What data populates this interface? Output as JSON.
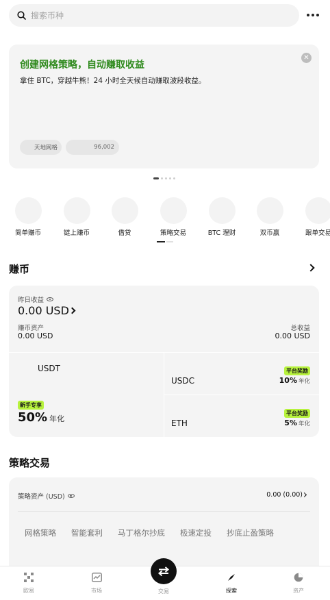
{
  "search": {
    "placeholder": "搜索币种"
  },
  "banner": {
    "title": "创建网格策略，自动赚取收益",
    "subtitle": "拿住 BTC，穿越牛熊！24 小时全天候自动赚取波段收益。",
    "chip_left": "天地网格",
    "chip_right": "96,002",
    "pages": 5,
    "active_page": 0
  },
  "shortcuts": [
    {
      "label": "简单赚币"
    },
    {
      "label": "链上赚币"
    },
    {
      "label": "借贷"
    },
    {
      "label": "策略交易"
    },
    {
      "label": "BTC 理财"
    },
    {
      "label": "双币赢"
    },
    {
      "label": "跟单交易"
    }
  ],
  "earn": {
    "title": "赚币",
    "yesterday_label": "昨日收益",
    "yesterday_value": "0.00 USD",
    "assets_label": "赚币资产",
    "assets_value": "0.00 USD",
    "total_label": "总收益",
    "total_value": "0.00 USD",
    "products": {
      "usdt": {
        "coin": "USDT",
        "badge": "新手专享",
        "rate": "50%",
        "unit": "年化"
      },
      "usdc": {
        "coin": "USDC",
        "badge": "平台奖励",
        "rate": "10%",
        "unit": "年化"
      },
      "eth": {
        "coin": "ETH",
        "badge": "平台奖励",
        "rate": "5%",
        "unit": "年化"
      }
    }
  },
  "strategy": {
    "title": "策略交易",
    "assets_label": "策略资产 (USD)",
    "assets_value": "0.00 (0.00)",
    "tabs": [
      "网格策略",
      "智能套利",
      "马丁格尔抄底",
      "极速定投",
      "抄底止盈策略"
    ]
  },
  "nav": {
    "items": [
      "欧易",
      "市场",
      "交易",
      "探索",
      "资产"
    ],
    "active": "探索"
  },
  "colors": {
    "accent_green": "#2f8a1d",
    "badge_lime": "#b7f23d"
  }
}
